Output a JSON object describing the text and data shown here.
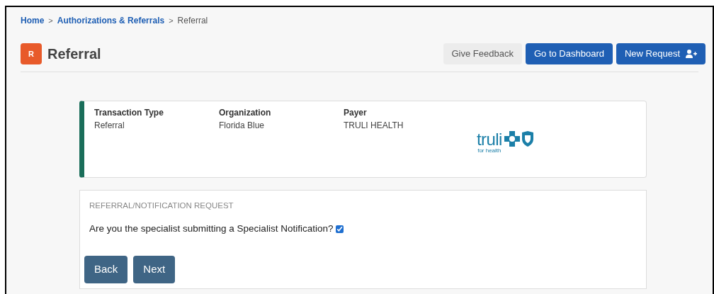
{
  "breadcrumb": [
    {
      "label": "Home",
      "link": true
    },
    {
      "label": "Authorizations & Referrals",
      "link": true
    },
    {
      "label": "Referral",
      "link": false
    }
  ],
  "breadcrumb_separator": ">",
  "header": {
    "badge": "R",
    "title": "Referral",
    "buttons": [
      {
        "label": "Give Feedback",
        "kind": "secondary"
      },
      {
        "label": "Go to Dashboard",
        "kind": "primary"
      },
      {
        "label": "New Request",
        "kind": "primary-icon"
      }
    ]
  },
  "summary": {
    "fields": [
      {
        "label": "Transaction Type",
        "value": "Referral"
      },
      {
        "label": "Organization",
        "value": "Florida Blue"
      },
      {
        "label": "Payer",
        "value": "TRULI HEALTH"
      }
    ],
    "logo": {
      "name": "truli",
      "tagline": "for health"
    }
  },
  "request": {
    "heading": "REFERRAL/NOTIFICATION REQUEST",
    "question": "Are you the specialist submitting a Specialist Notification?",
    "checked": true,
    "buttons": [
      "Back",
      "Next"
    ]
  }
}
